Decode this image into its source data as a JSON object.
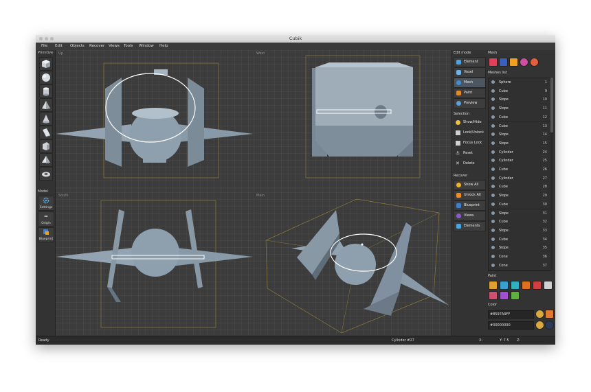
{
  "app": {
    "title": "Cubik"
  },
  "menu": [
    "File",
    "Edit",
    "Objects",
    "Recover",
    "Views",
    "Tools",
    "Window",
    "Help"
  ],
  "left_panel": {
    "primitive_title": "Primitive",
    "primitives": [
      "cube-icon",
      "sphere-icon",
      "cylinder-icon",
      "pyramid-icon",
      "cone-icon",
      "slope-icon",
      "wedge-icon",
      "prism-icon",
      "torus-icon"
    ],
    "model_title": "Model",
    "model_buttons": [
      {
        "label": "Settings",
        "icon": "gear-icon"
      },
      {
        "label": "Origin",
        "icon": "origin-icon"
      },
      {
        "label": "Blueprint",
        "icon": "blueprint-icon"
      }
    ]
  },
  "viewports": {
    "up": "Up",
    "west": "West",
    "south": "South",
    "main": "Main"
  },
  "edit_mode": {
    "title": "Edit mode",
    "buttons": [
      {
        "label": "Element",
        "color": "#4da3e0",
        "selected": false
      },
      {
        "label": "Voxel",
        "color": "#6fb2e8",
        "selected": false
      },
      {
        "label": "Mesh",
        "color": "#3d8fd6",
        "selected": true
      },
      {
        "label": "Paint",
        "color": "#e08a2c",
        "selected": false
      },
      {
        "label": "Preview",
        "color": "#5aa0d8",
        "selected": false
      }
    ]
  },
  "selection": {
    "title": "Selection",
    "items": [
      "Show/Hide",
      "Lock/Unlock",
      "Focus Lock",
      "Reset",
      "Delete"
    ]
  },
  "recover": {
    "title": "Recover",
    "buttons": [
      {
        "label": "Show All",
        "color": "#f0b030"
      },
      {
        "label": "Unlock All",
        "color": "#f08c20"
      },
      {
        "label": "Blueprint",
        "color": "#3f7fd0"
      },
      {
        "label": "Views",
        "color": "#8a5ad0"
      },
      {
        "label": "Elements",
        "color": "#4da3e0"
      }
    ]
  },
  "mesh_panel": {
    "title": "Mesh",
    "tools": [
      {
        "icon": "mesh-add-icon",
        "color": "#e0405a"
      },
      {
        "icon": "mesh-select-icon",
        "color": "#3a5fc0"
      },
      {
        "icon": "mesh-layers-icon",
        "color": "#f0a020"
      },
      {
        "icon": "mesh-color-icon",
        "color": "#d04fa0"
      },
      {
        "icon": "mesh-palette-icon",
        "color": "#e06040"
      }
    ],
    "list_title": "Meshes list",
    "meshes": [
      {
        "name": "Sphere",
        "id": "1"
      },
      {
        "name": "Cube",
        "id": "9"
      },
      {
        "name": "Slope",
        "id": "10"
      },
      {
        "name": "Slope",
        "id": "11"
      },
      {
        "name": "Cube",
        "id": "12"
      },
      {
        "name": "Cube",
        "id": "13"
      },
      {
        "name": "Slope",
        "id": "14"
      },
      {
        "name": "Slope",
        "id": "15"
      },
      {
        "name": "Cylinder",
        "id": "24"
      },
      {
        "name": "Cylinder",
        "id": "25"
      },
      {
        "name": "Cube",
        "id": "26"
      },
      {
        "name": "Cylinder",
        "id": "27"
      },
      {
        "name": "Cube",
        "id": "28"
      },
      {
        "name": "Slope",
        "id": "29"
      },
      {
        "name": "Cube",
        "id": "30"
      },
      {
        "name": "Slope",
        "id": "31"
      },
      {
        "name": "Cube",
        "id": "32"
      },
      {
        "name": "Slope",
        "id": "33"
      },
      {
        "name": "Cube",
        "id": "34"
      },
      {
        "name": "Slope",
        "id": "35"
      },
      {
        "name": "Cone",
        "id": "36"
      },
      {
        "name": "Cone",
        "id": "37"
      }
    ]
  },
  "paint_panel": {
    "title": "Paint",
    "tools": [
      {
        "icon": "brush-icon",
        "color": "#e0a030"
      },
      {
        "icon": "line-icon",
        "color": "#3aa0d0"
      },
      {
        "icon": "rect-icon",
        "color": "#30b0c0"
      },
      {
        "icon": "brush-orange-icon",
        "color": "#e07020"
      },
      {
        "icon": "brush-red-icon",
        "color": "#d04040"
      },
      {
        "icon": "eraser-icon",
        "color": "#d0d0d0"
      },
      {
        "icon": "fill-icon",
        "color": "#d05070"
      },
      {
        "icon": "picker-icon",
        "color": "#a050d0"
      },
      {
        "icon": "texture-icon",
        "color": "#60b040"
      }
    ]
  },
  "color_panel": {
    "title": "Color",
    "primary": "#8597A9FF",
    "secondary": "#00000000"
  },
  "status_bar": {
    "state": "Ready",
    "selection": "Cylinder #27",
    "x_label": "X:",
    "y_label": "Y: 7.5",
    "z_label": "Z:"
  }
}
